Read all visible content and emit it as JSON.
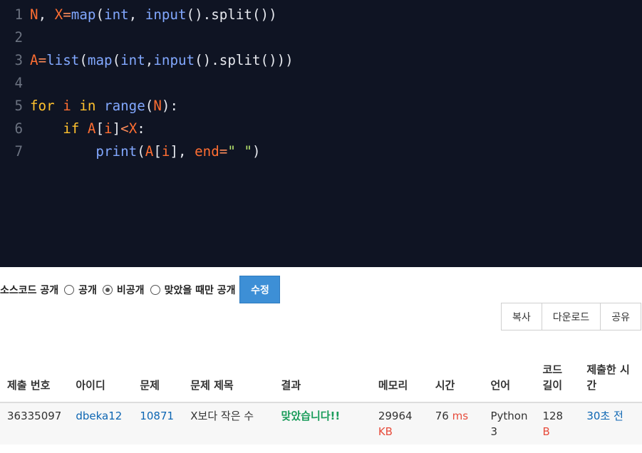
{
  "editor": {
    "lines": [
      {
        "no": "1",
        "tokens": [
          {
            "t": "N",
            "c": "var"
          },
          {
            "t": ", ",
            "c": "plain"
          },
          {
            "t": "X",
            "c": "var"
          },
          {
            "t": "=",
            "c": "op"
          },
          {
            "t": "map",
            "c": "fn"
          },
          {
            "t": "(",
            "c": "plain"
          },
          {
            "t": "int",
            "c": "type"
          },
          {
            "t": ", ",
            "c": "plain"
          },
          {
            "t": "input",
            "c": "fn"
          },
          {
            "t": "().split())",
            "c": "plain"
          }
        ]
      },
      {
        "no": "2",
        "tokens": []
      },
      {
        "no": "3",
        "tokens": [
          {
            "t": "A",
            "c": "var"
          },
          {
            "t": "=",
            "c": "op"
          },
          {
            "t": "list",
            "c": "fn"
          },
          {
            "t": "(",
            "c": "plain"
          },
          {
            "t": "map",
            "c": "fn"
          },
          {
            "t": "(",
            "c": "plain"
          },
          {
            "t": "int",
            "c": "type"
          },
          {
            "t": ",",
            "c": "plain"
          },
          {
            "t": "input",
            "c": "fn"
          },
          {
            "t": "().split()))",
            "c": "plain"
          }
        ]
      },
      {
        "no": "4",
        "tokens": []
      },
      {
        "no": "5",
        "tokens": [
          {
            "t": "for",
            "c": "kw"
          },
          {
            "t": " ",
            "c": "plain"
          },
          {
            "t": "i",
            "c": "var"
          },
          {
            "t": " ",
            "c": "plain"
          },
          {
            "t": "in",
            "c": "kw"
          },
          {
            "t": " ",
            "c": "plain"
          },
          {
            "t": "range",
            "c": "fn"
          },
          {
            "t": "(",
            "c": "plain"
          },
          {
            "t": "N",
            "c": "var"
          },
          {
            "t": "):",
            "c": "plain"
          }
        ]
      },
      {
        "no": "6",
        "tokens": [
          {
            "t": "    ",
            "c": "plain"
          },
          {
            "t": "if",
            "c": "kw"
          },
          {
            "t": " ",
            "c": "plain"
          },
          {
            "t": "A",
            "c": "var"
          },
          {
            "t": "[",
            "c": "plain"
          },
          {
            "t": "i",
            "c": "var"
          },
          {
            "t": "]",
            "c": "plain"
          },
          {
            "t": "<",
            "c": "op"
          },
          {
            "t": "X",
            "c": "var"
          },
          {
            "t": ":",
            "c": "plain"
          }
        ]
      },
      {
        "no": "7",
        "tokens": [
          {
            "t": "        ",
            "c": "plain"
          },
          {
            "t": "print",
            "c": "fn"
          },
          {
            "t": "(",
            "c": "plain"
          },
          {
            "t": "A",
            "c": "var"
          },
          {
            "t": "[",
            "c": "plain"
          },
          {
            "t": "i",
            "c": "var"
          },
          {
            "t": "], ",
            "c": "plain"
          },
          {
            "t": "end",
            "c": "var"
          },
          {
            "t": "=",
            "c": "op"
          },
          {
            "t": "\" \"",
            "c": "str"
          },
          {
            "t": ")",
            "c": "plain"
          }
        ]
      }
    ]
  },
  "share": {
    "label": "소스코드 공개",
    "options": [
      {
        "label": "공개",
        "checked": false
      },
      {
        "label": "비공개",
        "checked": true
      },
      {
        "label": "맞았을 때만 공개",
        "checked": false
      }
    ],
    "edit_button": "수정"
  },
  "actions": {
    "copy": "복사",
    "download": "다운로드",
    "share": "공유"
  },
  "table": {
    "headers": {
      "submission_no": "제출 번호",
      "user_id": "아이디",
      "problem": "문제",
      "problem_title": "문제 제목",
      "result": "결과",
      "memory": "메모리",
      "time": "시간",
      "language": "언어",
      "code_length": "코드 길이",
      "submitted_at": "제출한 시간"
    },
    "row": {
      "submission_no": "36335097",
      "user_id": "dbeka12",
      "problem": "10871",
      "problem_title": "X보다 작은 수",
      "result": "맞았습니다!!",
      "memory": "29964",
      "memory_unit": "KB",
      "time": "76",
      "time_unit": "ms",
      "language": "Python 3",
      "code_length": "128",
      "code_length_unit": "B",
      "submitted_at": "30초 전"
    }
  },
  "colors": {
    "editor_bg": "#0f1423",
    "accent": "#3d8fd6",
    "ok": "#1a9c5a",
    "unit": "#e74c3c",
    "link": "#0d66b3"
  }
}
